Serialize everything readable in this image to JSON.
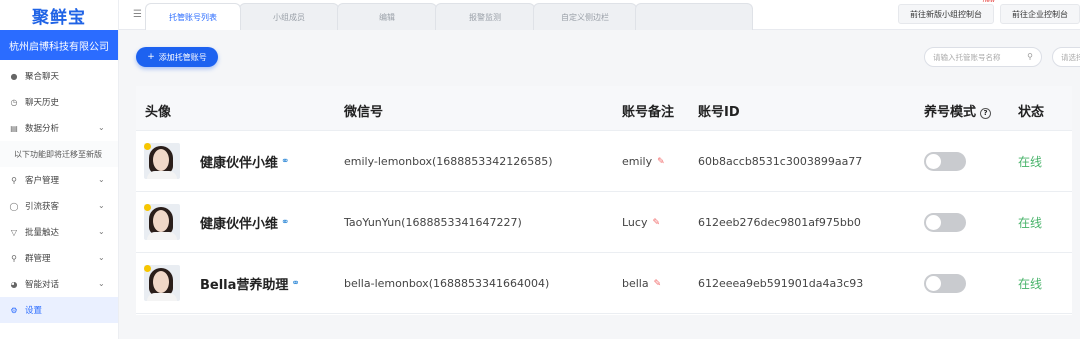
{
  "sidebar": {
    "logo": "聚鲜宝",
    "company": "杭州启博科技有限公司",
    "items": [
      {
        "label": "聚合聊天"
      },
      {
        "label": "聊天历史"
      },
      {
        "label": "数据分析"
      },
      {
        "label": "客户管理"
      },
      {
        "label": "引流获客"
      },
      {
        "label": "批量触达"
      },
      {
        "label": "群管理"
      },
      {
        "label": "智能对话"
      },
      {
        "label": "设置"
      }
    ],
    "note": "以下功能即将迁移至新版"
  },
  "tabs": [
    {
      "label": "托管账号列表"
    },
    {
      "label": "小组成员"
    },
    {
      "label": "编辑"
    },
    {
      "label": "报警监测"
    },
    {
      "label": "自定义侧边栏"
    },
    {
      "label": ""
    }
  ],
  "header": {
    "btn_new_console": "前往新版小组控制台",
    "new_badge": "new",
    "btn_enterprise": "前往企业控制台"
  },
  "toolbar": {
    "add_label": "添加托管账号",
    "search_placeholder": "请输入托管账号名称",
    "select_placeholder": "请选择"
  },
  "table": {
    "headers": {
      "avatar": "头像",
      "wechat": "微信号",
      "remark": "账号备注",
      "account_id": "账号ID",
      "mode": "养号模式",
      "status": "状态"
    },
    "rows": [
      {
        "name": "健康伙伴小维",
        "wechat": "emily-lemonbox(1688853342126585)",
        "remark": "emily",
        "account_id": "60b8accb8531c3003899aa77",
        "status": "在线"
      },
      {
        "name": "健康伙伴小维",
        "wechat": "TaoYunYun(1688853341647227)",
        "remark": "Lucy",
        "account_id": "612eeb276dec9801af975bb0",
        "status": "在线"
      },
      {
        "name": "Bella营养助理",
        "wechat": "bella-lemonbox(1688853341664004)",
        "remark": "bella",
        "account_id": "612eeea9eb591901da4a3c93",
        "status": "在线"
      }
    ]
  },
  "colors": {
    "brand": "#2b6cff",
    "online": "#48b36a"
  }
}
